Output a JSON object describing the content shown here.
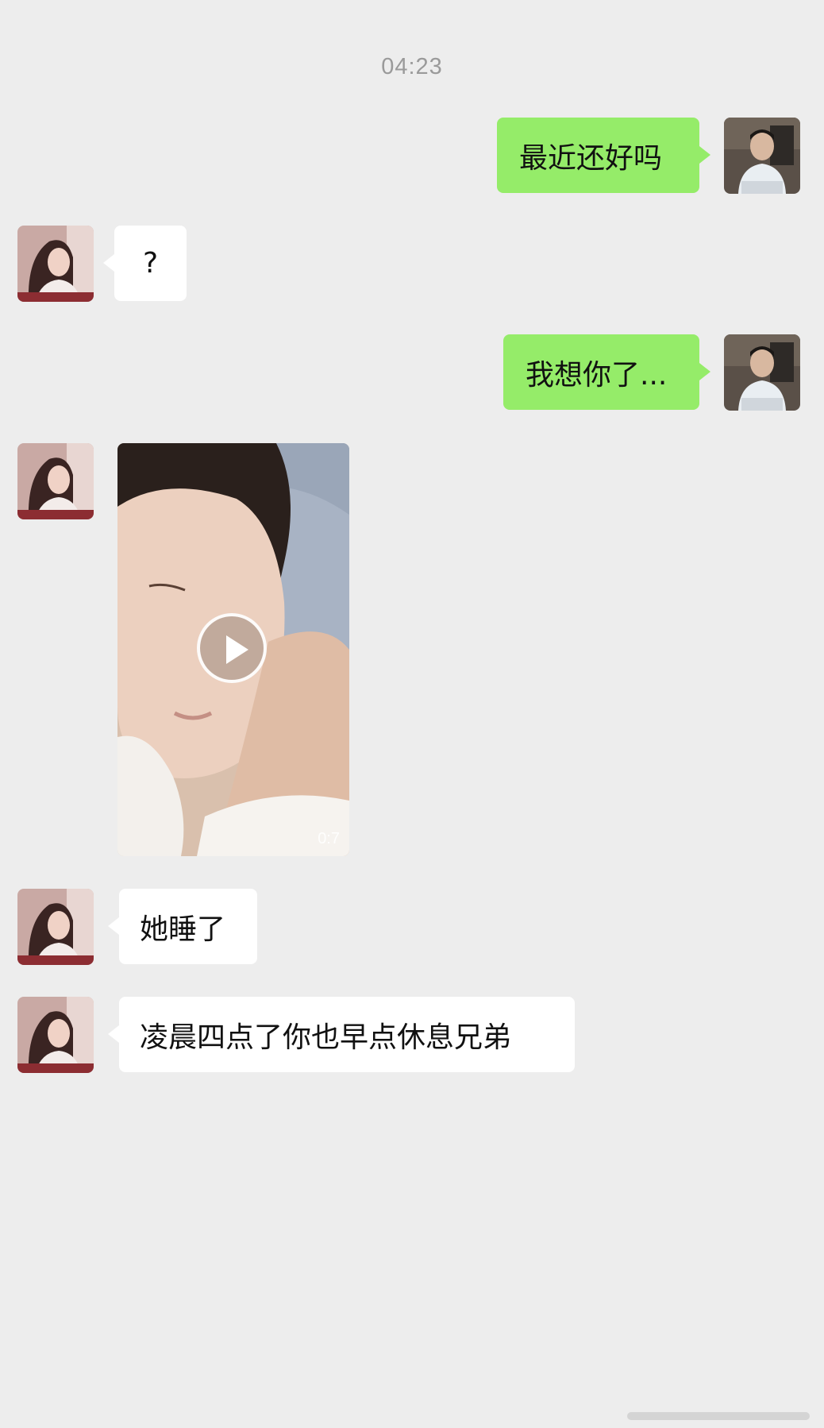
{
  "chat": {
    "timestamp": "04:23",
    "messages": [
      {
        "sender": "me",
        "text": "最近还好吗"
      },
      {
        "sender": "them",
        "text": "?"
      },
      {
        "sender": "me",
        "text": "我想你了..."
      },
      {
        "sender": "them",
        "type": "video",
        "duration": "0:7"
      },
      {
        "sender": "them",
        "text": "她睡了"
      },
      {
        "sender": "them",
        "text": "凌晨四点了你也早点休息兄弟"
      }
    ]
  },
  "colors": {
    "background": "#ededed",
    "outgoing_bubble": "#95ec69",
    "incoming_bubble": "#ffffff",
    "timestamp_text": "#9a9a9a"
  },
  "icons": {
    "play": "play-icon"
  }
}
